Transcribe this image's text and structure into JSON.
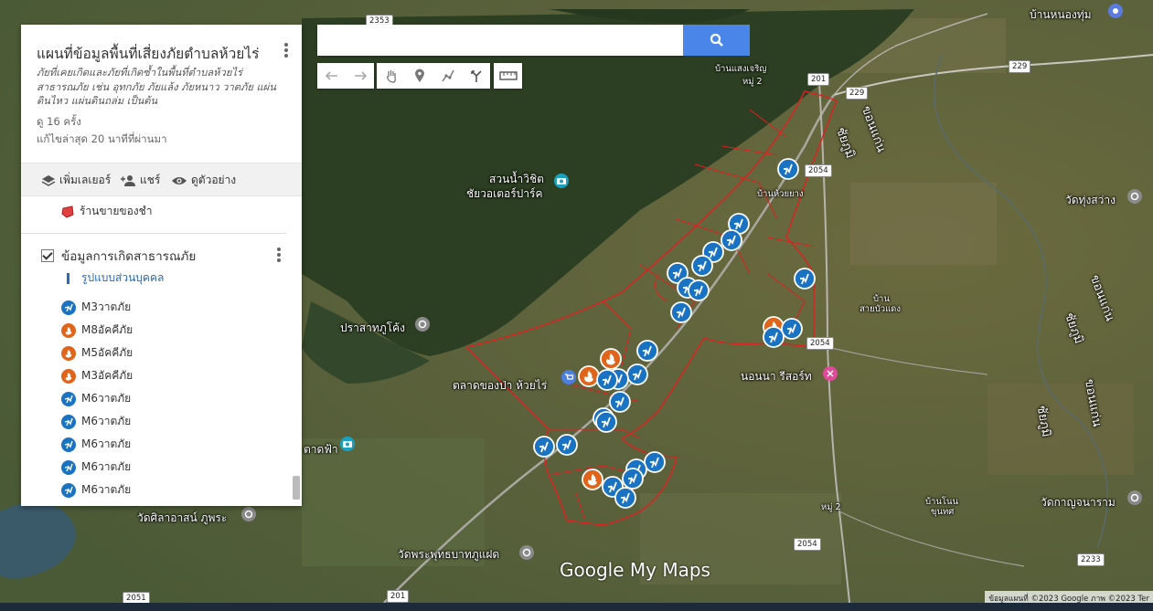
{
  "panel": {
    "title": "แผนที่ข้อมูลพื้นที่เสี่ยงภัยตำบลห้วยไร่",
    "description": "ภัยที่เคยเกิดและภัยที่เกิดซ้ำในพื้นที่ตำบลห้วยไร่ สาธารณภัย เช่น อุทกภัย ภัยแล้ง ภัยหนาว วาตภัย แผ่นดินไหว แผ่นดินถล่ม เป็นต้น",
    "views": "ดู 16 ครั้ง",
    "last_edited": "แก้ไขล่าสุด 20 นาทีที่ผ่านมา",
    "actions": {
      "add_layer": "เพิ่มเลเยอร์",
      "share": "แชร์",
      "preview": "ดูตัวอย่าง"
    },
    "base_layer": "ร้านขายของชำ",
    "layer": {
      "title": "ข้อมูลการเกิดสาธารณภัย",
      "style_link": "รูปแบบส่วนบุคคล",
      "items": [
        {
          "label": "M3วาตภัย",
          "icon": "wind"
        },
        {
          "label": "M8อัคคีภัย",
          "icon": "fire"
        },
        {
          "label": "M5อัคคีภัย",
          "icon": "fire"
        },
        {
          "label": "M3อัคคีภัย",
          "icon": "fire"
        },
        {
          "label": "M6วาตภัย",
          "icon": "wind"
        },
        {
          "label": "M6วาตภัย",
          "icon": "wind"
        },
        {
          "label": "M6วาตภัย",
          "icon": "wind"
        },
        {
          "label": "M6วาตภัย",
          "icon": "wind"
        },
        {
          "label": "M6วาตภัย",
          "icon": "wind"
        }
      ]
    }
  },
  "search": {
    "value": ""
  },
  "map": {
    "places": {
      "baan_nongtum": "บ้านหนองทุ่ม",
      "baan_saengcharoen": "บ้านแสงเจริญ",
      "moo2_top": "หมู่ 2",
      "khonkaen_1": "ขอนแก่น",
      "chaiyaphum_1": "ชัยภูมิ",
      "suan_nam": "สวนน้ำวิชิต",
      "chaiwo": "ชัยวอเตอร์ปาร์ค",
      "baan_huaiyang": "บ้านห้วยยาง",
      "wat_thungsawang": "วัดทุ่งสว่าง",
      "baan_saibuadaeng_1": "บ้าน",
      "baan_saibuadaeng_2": "สายบัวแดง",
      "khonkaen_2": "ขอนแก่น",
      "chaiyaphum_2": "ชัยภูมิ",
      "prasat": "ปราสาทภูโค้ง",
      "talad": "ตลาดของป่า ห้วยไร่",
      "nonna": "นอนนา รีสอร์ท",
      "chaiyaphum_3": "ชัยภูมิ",
      "khonkaen_3": "ขอนแก่น",
      "tadfa": "ตาดฟ้า",
      "moo2_bottom": "หมู่ 2",
      "baan_nonkhunthet_1": "บ้านโนน",
      "baan_nonkhunthet_2": "ขุนทศ",
      "wat_kanchanaram": "วัดกาญจนาราม",
      "wat_sila": "วัดศิลาอาสน์ ภูพระ",
      "wat_phraputtabat": "วัดพระพุทธบาทภูแฝด"
    },
    "roads": [
      "2353",
      "201",
      "229",
      "229",
      "2054",
      "2054",
      "2054",
      "2233",
      "2051",
      "201"
    ],
    "logo": "Google My Maps",
    "attribution": "ข้อมูลแผนที่ ©2023 Google ภาพ ©2023 Ter"
  },
  "colors": {
    "wind": "#1a73c2",
    "fire": "#e0641a",
    "boundary": "#e02020",
    "search_button": "#4a86e8"
  }
}
